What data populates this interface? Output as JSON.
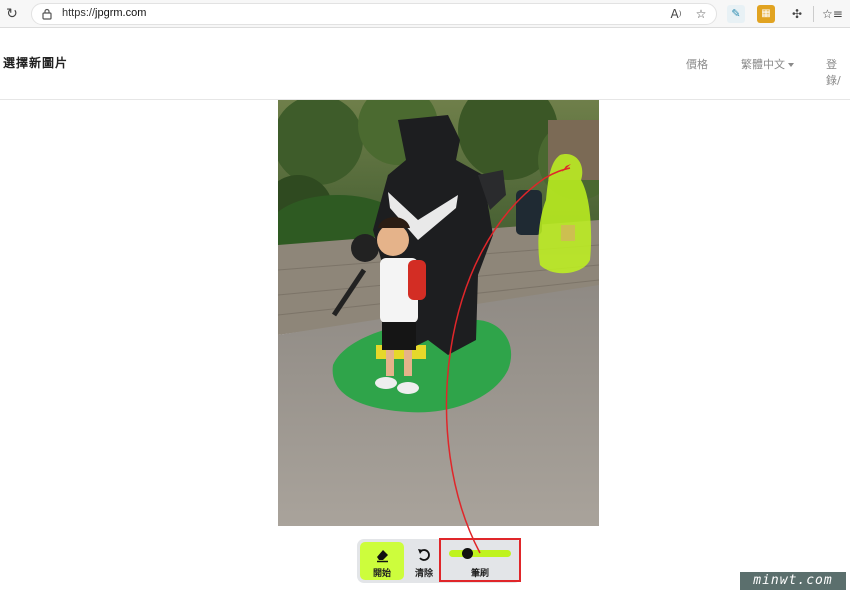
{
  "browser": {
    "url_scheme": "https://",
    "url_host": "jpgrm.com",
    "reader_icon": "reader-mode-icon",
    "favorite_icon": "star-add-icon"
  },
  "header": {
    "title": "選擇新圖片",
    "nav": {
      "pricing": "價格",
      "language": "繁體中文",
      "login": "登錄/"
    }
  },
  "toolbar": {
    "start_label": "開始",
    "clear_label": "清除",
    "brush_label": "筆刷",
    "brush_size_fraction": 0.25,
    "active_color": "#cdfd3c"
  },
  "watermark": {
    "text": "minwt.com"
  },
  "colors": {
    "highlight": "#bff31f",
    "annotation_red": "#e0262a"
  }
}
